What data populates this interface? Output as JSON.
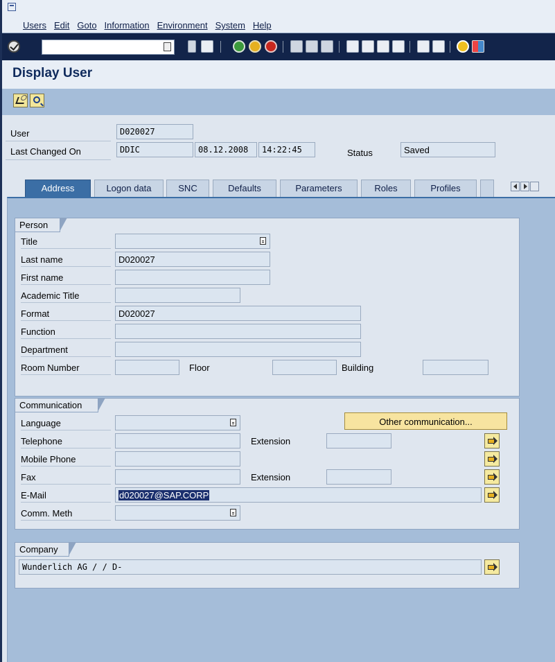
{
  "menu": {
    "items": [
      "Users",
      "Edit",
      "Goto",
      "Information",
      "Environment",
      "System",
      "Help"
    ]
  },
  "toolbar": {
    "command_value": "",
    "icons": [
      "enter-icon",
      "back-icon",
      "save-icon",
      "back-icon",
      "exit-icon",
      "cancel-icon",
      "print-icon",
      "find-icon",
      "find-next-icon",
      "first-page-icon",
      "previous-page-icon",
      "next-page-icon",
      "last-page-icon",
      "create-session-icon",
      "shortcut-icon",
      "help-icon",
      "customize-layout-icon"
    ]
  },
  "page": {
    "title": "Display User"
  },
  "header": {
    "user_label": "User",
    "user_value": "D020027",
    "last_changed_label": "Last Changed On",
    "last_changed_by": "DDIC",
    "last_changed_date": "08.12.2008",
    "last_changed_time": "14:22:45",
    "status_label": "Status",
    "status_value": "Saved"
  },
  "tabs": [
    {
      "label": "Address",
      "active": true
    },
    {
      "label": "Logon data",
      "active": false
    },
    {
      "label": "SNC",
      "active": false
    },
    {
      "label": "Defaults",
      "active": false
    },
    {
      "label": "Parameters",
      "active": false
    },
    {
      "label": "Roles",
      "active": false
    },
    {
      "label": "Profiles",
      "active": false
    }
  ],
  "person": {
    "header": "Person",
    "title_label": "Title",
    "title_value": "",
    "last_name_label": "Last name",
    "last_name_value": "D020027",
    "first_name_label": "First name",
    "first_name_value": "",
    "academic_title_label": "Academic Title",
    "academic_title_value": "",
    "format_label": "Format",
    "format_value": "D020027",
    "function_label": "Function",
    "function_value": "",
    "department_label": "Department",
    "department_value": "",
    "room_label": "Room Number",
    "room_value": "",
    "floor_label": "Floor",
    "floor_value": "",
    "building_label": "Building",
    "building_value": ""
  },
  "communication": {
    "header": "Communication",
    "language_label": "Language",
    "language_value": "",
    "other_button": "Other communication...",
    "telephone_label": "Telephone",
    "telephone_value": "",
    "extension_label": "Extension",
    "extension_value": "",
    "mobile_label": "Mobile Phone",
    "mobile_value": "",
    "fax_label": "Fax",
    "fax_value": "",
    "fax_extension_label": "Extension",
    "fax_extension_value": "",
    "email_label": "E-Mail",
    "email_value": "d020027@SAP.CORP",
    "comm_meth_label": "Comm. Meth",
    "comm_meth_value": ""
  },
  "company": {
    "header": "Company",
    "value": "Wunderlich AG / / D-"
  },
  "colors": {
    "accent": "#3b6ea5",
    "toolbar_bg": "#12244a",
    "app_toolbar_bg": "#a5bdd9",
    "highlight": "#1b2f6e"
  }
}
